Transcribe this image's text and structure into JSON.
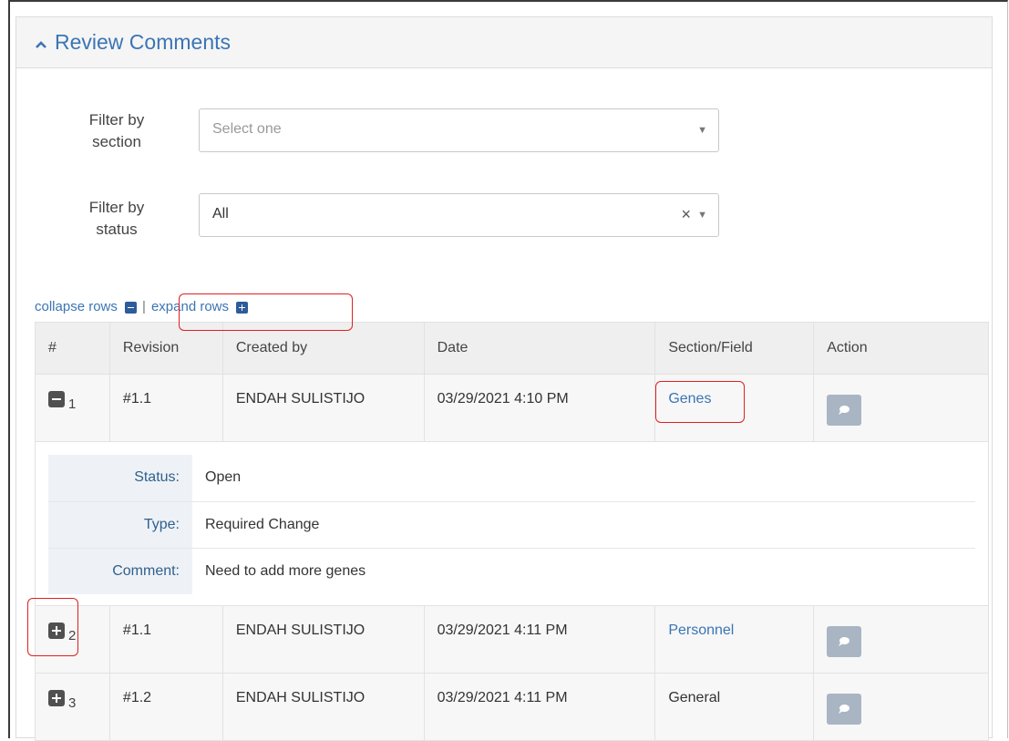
{
  "panel": {
    "title": "Review Comments"
  },
  "filters": {
    "section": {
      "label_line1": "Filter by",
      "label_line2": "section",
      "placeholder": "Select one"
    },
    "status": {
      "label_line1": "Filter by",
      "label_line2": "status",
      "value": "All",
      "clear": "×"
    }
  },
  "toggles": {
    "collapse": "collapse rows",
    "separator": "|",
    "expand": "expand rows"
  },
  "table": {
    "headers": {
      "num": "#",
      "revision": "Revision",
      "created_by": "Created by",
      "date": "Date",
      "section": "Section/Field",
      "action": "Action"
    },
    "rows": [
      {
        "num": "1",
        "revision": "#1.1",
        "created_by": "ENDAH SULISTIJO",
        "date": "03/29/2021 4:10 PM",
        "section": "Genes"
      },
      {
        "num": "2",
        "revision": "#1.1",
        "created_by": "ENDAH SULISTIJO",
        "date": "03/29/2021 4:11 PM",
        "section": "Personnel"
      },
      {
        "num": "3",
        "revision": "#1.2",
        "created_by": "ENDAH SULISTIJO",
        "date": "03/29/2021 4:11 PM",
        "section": "General"
      }
    ],
    "detail": {
      "status_label": "Status:",
      "status_value": "Open",
      "type_label": "Type:",
      "type_value": "Required Change",
      "comment_label": "Comment:",
      "comment_value": "Need to add more genes"
    }
  },
  "colors": {
    "link": "#3b75b4",
    "highlight": "#e02020",
    "action_button": "#a9b5c2"
  },
  "icons": {
    "panel_toggle": "chevron-up-icon",
    "action": "comment-bubble-icon",
    "expand": "plus-square-icon",
    "collapse": "minus-square-icon"
  }
}
